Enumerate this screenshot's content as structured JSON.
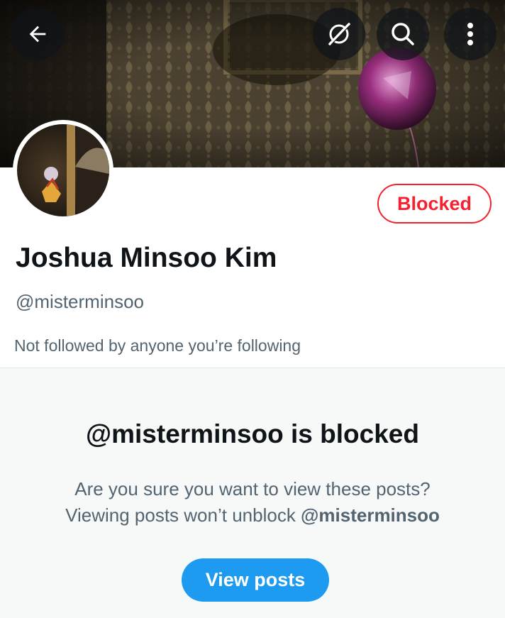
{
  "header": {
    "back_icon": "arrow-left-icon",
    "grok_icon": "grok-icon",
    "search_icon": "search-icon",
    "more_icon": "more-vertical-icon"
  },
  "profile": {
    "display_name": "Joshua Minsoo Kim",
    "handle": "@misterminsoo",
    "followers_note": "Not followed by anyone you’re following",
    "blocked_label": "Blocked"
  },
  "blocked_notice": {
    "title": "@misterminsoo is blocked",
    "line1": "Are you sure you want to view these posts?",
    "line2_prefix": "Viewing posts won’t unblock ",
    "line2_handle": "@misterminsoo",
    "button_label": "View posts"
  },
  "colors": {
    "blocked_red": "#f4212e",
    "accent_blue": "#1d9bf0",
    "text_primary": "#0f1419",
    "text_secondary": "#536471",
    "panel_bg": "#f7f9f9"
  }
}
